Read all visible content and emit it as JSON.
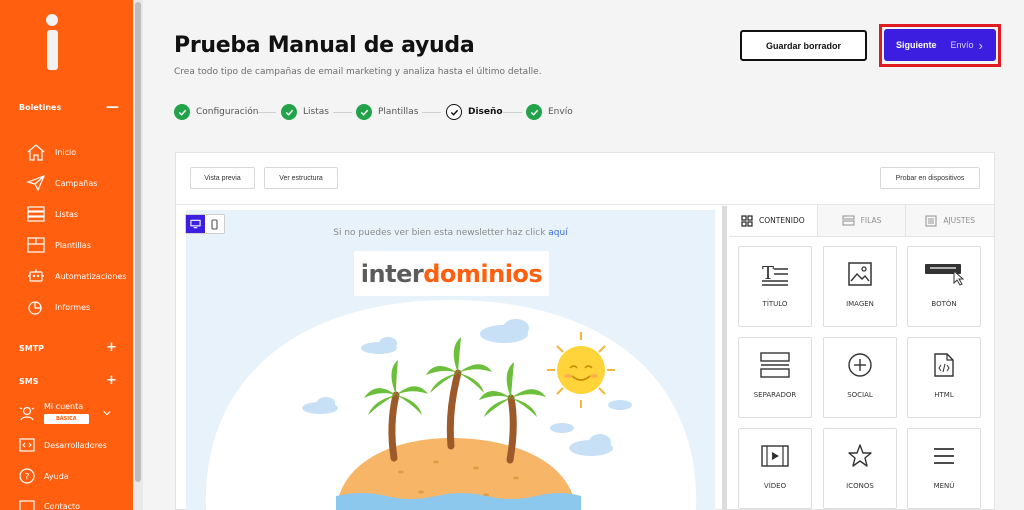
{
  "sidebar": {
    "section_boletines": "Boletines",
    "section_boletines_toggle": "—",
    "items": [
      {
        "label": "Inicio",
        "icon": "home-icon"
      },
      {
        "label": "Campañas",
        "icon": "paper-plane-icon"
      },
      {
        "label": "Listas",
        "icon": "list-icon"
      },
      {
        "label": "Plantillas",
        "icon": "template-icon"
      },
      {
        "label": "Automatizaciones",
        "icon": "robot-icon"
      },
      {
        "label": "Informes",
        "icon": "chart-icon"
      }
    ],
    "section_smtp": "SMTP",
    "section_sms": "SMS",
    "toggle_plus": "+",
    "account": {
      "label": "Mi cuenta",
      "plan": "BÁSICA"
    },
    "developers": "Desarrolladores",
    "help": "Ayuda",
    "contact": "Contacto"
  },
  "header": {
    "title": "Prueba Manual de ayuda",
    "subtitle": "Crea todo tipo de campañas de email marketing y analiza hasta el último detalle.",
    "save_draft": "Guardar borrador",
    "next_label": "Siguiente",
    "next_step": "Envío",
    "next_chevron": "›"
  },
  "stepper": [
    {
      "label": "Configuración",
      "done": true
    },
    {
      "label": "Listas",
      "done": true
    },
    {
      "label": "Plantillas",
      "done": true
    },
    {
      "label": "Diseño",
      "done": false
    },
    {
      "label": "Envío",
      "done": true
    }
  ],
  "editor": {
    "preview": "Vista previa",
    "structure": "Ver estructura",
    "test_devices": "Probar en dispositivos",
    "newsletter_link_text": "Si no puedes ver bien esta newsletter haz click",
    "newsletter_link_action": "aquí",
    "brand_part1": "inter",
    "brand_part2": "dominios"
  },
  "panel": {
    "tabs": [
      "CONTENIDO",
      "FILAS",
      "AJUSTES"
    ],
    "blocks": [
      {
        "label": "TÍTULO",
        "icon": "title-icon"
      },
      {
        "label": "IMAGEN",
        "icon": "image-icon"
      },
      {
        "label": "BOTÓN",
        "icon": "button-icon"
      },
      {
        "label": "SEPARADOR",
        "icon": "separator-icon"
      },
      {
        "label": "SOCIAL",
        "icon": "social-icon"
      },
      {
        "label": "HTML",
        "icon": "html-icon"
      },
      {
        "label": "VÍDEO",
        "icon": "video-icon"
      },
      {
        "label": "ICONOS",
        "icon": "star-icon"
      },
      {
        "label": "MENÚ",
        "icon": "menu-icon"
      }
    ]
  },
  "colors": {
    "brand": "#ff5f0f",
    "primary": "#3b1ee0",
    "success": "#22a34a",
    "highlight": "#e11b22"
  }
}
